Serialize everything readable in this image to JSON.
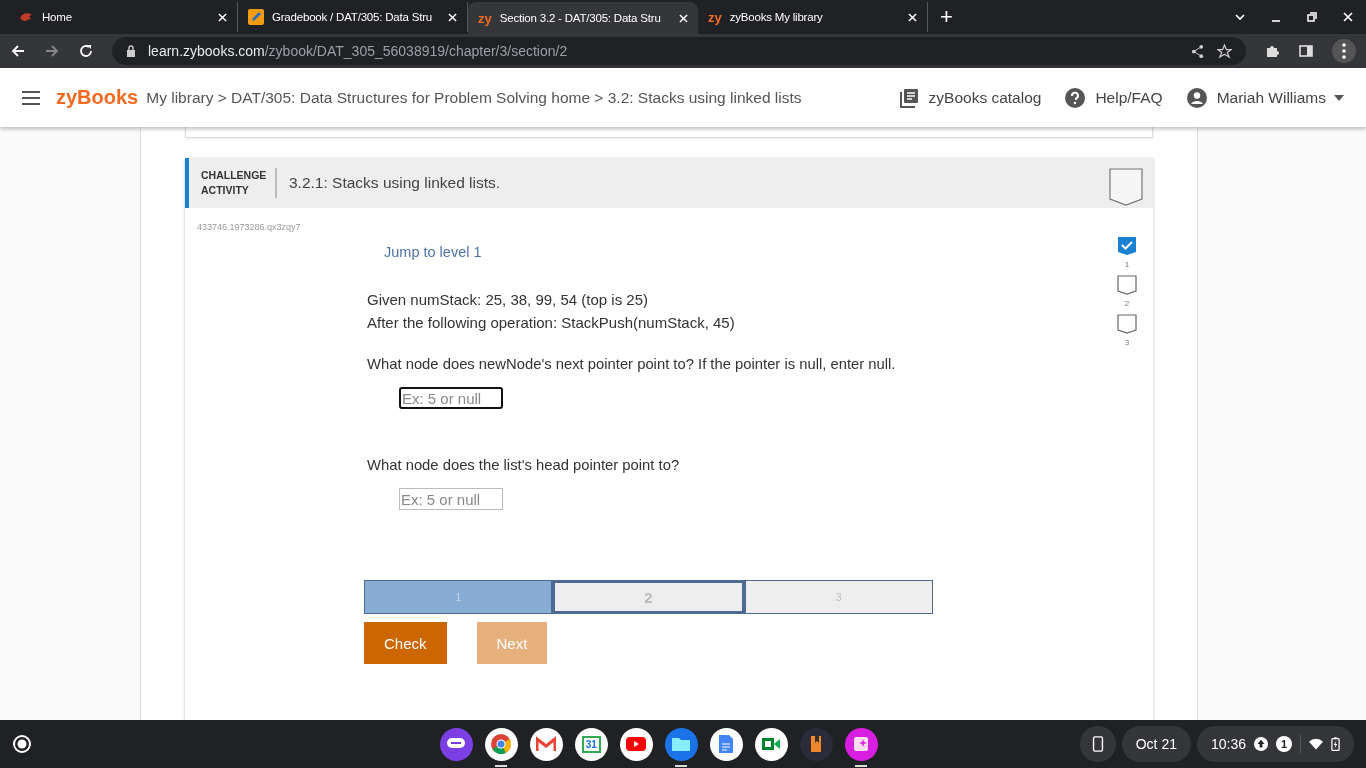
{
  "browser": {
    "tabs": [
      {
        "title": "Home",
        "selected": false
      },
      {
        "title": "Gradebook / DAT/305: Data Stru",
        "selected": false
      },
      {
        "title": "Section 3.2 - DAT/305: Data Stru",
        "favicon_text": "zy",
        "selected": true
      },
      {
        "title": "zyBooks My library",
        "favicon_text": "zy",
        "selected": false
      }
    ],
    "new_tab": "+",
    "url_host": "learn.zybooks.com",
    "url_path": "/zybook/DAT_305_56038919/chapter/3/section/2"
  },
  "header": {
    "logo": "zyBooks",
    "breadcrumb": "My library > DAT/305: Data Structures for Problem Solving home > 3.2: Stacks using linked lists",
    "catalog": "zyBooks catalog",
    "help": "Help/FAQ",
    "user": "Mariah Williams"
  },
  "activity": {
    "type_label": "CHALLENGE ACTIVITY",
    "title": "3.2.1: Stacks using linked lists.",
    "id": "433746.1973286.qx3zqy7",
    "jump": "Jump to level 1",
    "levels": [
      {
        "number": "1",
        "checked": true
      },
      {
        "number": "2",
        "checked": false
      },
      {
        "number": "3",
        "checked": false
      }
    ],
    "prompt_lines": [
      "Given numStack: 25, 38, 99, 54 (top is 25)",
      "After the following operation: StackPush(numStack, 45)"
    ],
    "questions": [
      {
        "text": "What node does newNode's next pointer point to? If the pointer is null, enter null.",
        "placeholder": "Ex: 5 or null",
        "focused": true
      },
      {
        "text": "What node does the list's head pointer point to?",
        "placeholder": "Ex: 5 or null",
        "focused": false
      }
    ],
    "progress": [
      {
        "label": "1",
        "completed": true,
        "selected": false
      },
      {
        "label": "2",
        "completed": false,
        "selected": true
      },
      {
        "label": "3",
        "completed": false,
        "selected": false
      }
    ],
    "check": "Check",
    "next": {
      "label": "Next",
      "disabled": true
    }
  },
  "shelf": {
    "apps": [
      {
        "running": false
      },
      {
        "running": true
      },
      {
        "running": false
      },
      {
        "running": false,
        "label": "31"
      },
      {
        "running": false
      },
      {
        "running": true
      },
      {
        "running": false
      },
      {
        "running": false
      },
      {
        "running": false
      },
      {
        "running": true
      }
    ],
    "date": "Oct 21",
    "time": "10:36",
    "notifications": "1"
  }
}
